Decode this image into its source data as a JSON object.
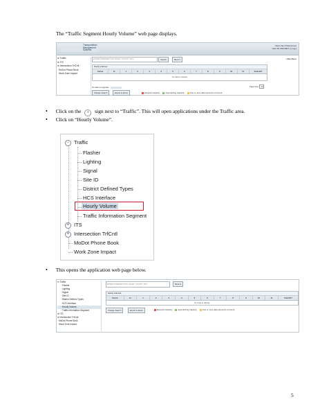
{
  "intro_text": "The “Traffic Segment Hourly Volume” web page displays.",
  "bullets": {
    "b1_pre": "Click on the",
    "b1_post": "sign next to “Traffic”. This will open applications under the Traffic area.",
    "b2": "Click on “Hourly Volume”.",
    "b3": "This opens the application web page below."
  },
  "page_number": "5",
  "ss1": {
    "brand": [
      "Transportation",
      "Management",
      "Systems"
    ],
    "top_right": [
      "Clear User Preferences",
      "User ID: MOUSET | [ Log ]",
      "Hide Menu"
    ],
    "sidebar": [
      "⊕ Traffic",
      "⊕ ITS",
      "⊕ Intersection TrfCntl",
      "· MoDot Phone Book",
      "· Work Zone Impact"
    ],
    "search_placeholder": "ENTER INTERSECTION, ROAD, COUNTY, ETC.",
    "search_button": "Search",
    "menu_button": "Menu ▾",
    "caption": "Hourly volumes",
    "columns": [
      "Period",
      "11",
      "1",
      "2",
      "3",
      "4",
      "5",
      "6",
      "7",
      "8",
      "9",
      "10",
      "11",
      "Total ADT"
    ],
    "no_data": "No data to display",
    "pager_text": "No data to paginate",
    "page_size_label": "Page Size:",
    "page_size_value": "10",
    "change_search": "Change Search",
    "export_excel": "Export to Excel",
    "legend": [
      "Exceeds Capacity",
      "Approaching Capacity",
      "One or more data elements not found"
    ],
    "legend_colors": [
      "#e0524d",
      "#8cc06e",
      "#f0c25a"
    ]
  },
  "ss2": {
    "traffic": "Traffic",
    "children": [
      "Flasher",
      "Lighting",
      "Signal",
      "Site ID",
      "District Defined Types",
      "HCS Interface",
      "Hourly Volume",
      "Traffic Information Segment"
    ],
    "its": "ITS",
    "intersection": "Intersection TrfCntl",
    "modot": "MoDot Phone Book",
    "workzone": "Work Zone Impact"
  },
  "ss3": {
    "sidebar": [
      "⊖ Traffic",
      "· Flasher",
      "· Lighting",
      "· Signal",
      "· Site ID",
      "· District Defined Types",
      "· HCS Interface",
      "· Hourly Volume",
      "· Traffic Information Segment",
      "⊕ ITS",
      "⊕ Intersection TrfCntl",
      "· MoDot Phone Book",
      "· Work Zone Impact"
    ],
    "search_placeholder": "ENTER INTERSECTION, ROAD, COUNTY, ETC.",
    "menu_button": "Menu ▾",
    "caption": "Hourly volumes",
    "columns": [
      "Period",
      "11",
      "1",
      "2",
      "3",
      "4",
      "5",
      "6",
      "7",
      "8",
      "9",
      "10",
      "11",
      "Total ADT"
    ],
    "no_data": "No data to display",
    "change_search": "Change Search",
    "export_excel": "Export to Excel",
    "legend": [
      "Exceeds Capacity",
      "Approaching Capacity",
      "One or more data elements not found"
    ],
    "legend_colors": [
      "#e0524d",
      "#8cc06e",
      "#f0c25a"
    ]
  }
}
